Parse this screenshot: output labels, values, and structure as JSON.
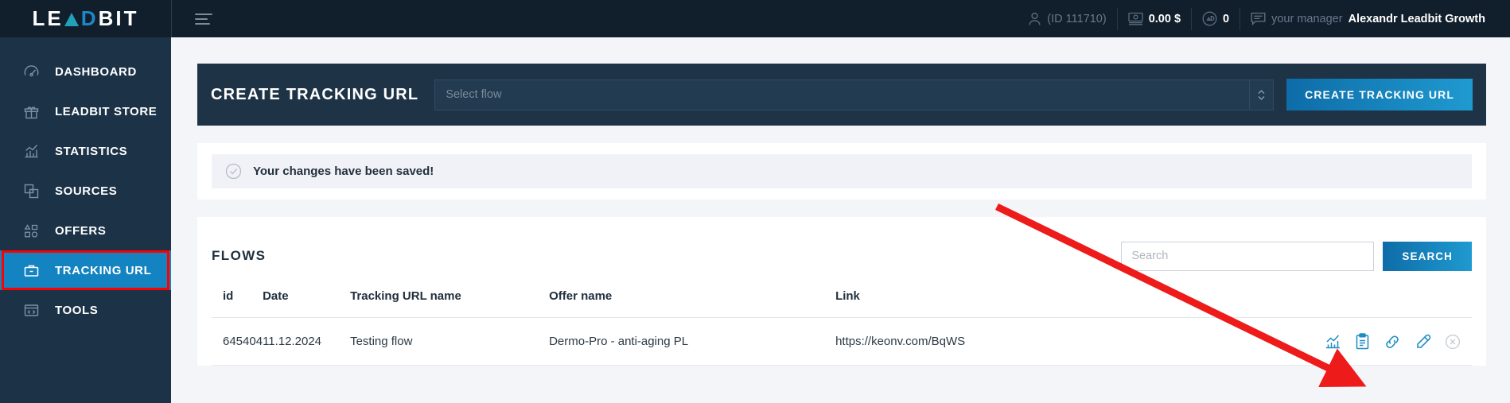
{
  "topbar": {
    "logo": {
      "part1": "LE",
      "triangle_icon": "triangle-a-icon",
      "part2": "D",
      "part3": "BIT"
    },
    "menu_icon": "hamburger-icon",
    "user_icon": "user-icon",
    "user_id": "(ID 111710)",
    "balance_icon": "wallet-icon",
    "balance": "0.00 $",
    "offers_icon": "shapes-badge-icon",
    "offers_count": "0",
    "manager_icon": "chat-icon",
    "manager_label": "your manager",
    "manager_name": "Alexandr Leadbit Growth"
  },
  "sidebar": {
    "items": [
      {
        "label": "DASHBOARD",
        "icon": "speedometer-icon",
        "active": false
      },
      {
        "label": "LEADBIT STORE",
        "icon": "gift-icon",
        "active": false
      },
      {
        "label": "STATISTICS",
        "icon": "bar-chart-icon",
        "active": false
      },
      {
        "label": "SOURCES",
        "icon": "layers-icon",
        "active": false
      },
      {
        "label": "OFFERS",
        "icon": "shapes-icon",
        "active": false
      },
      {
        "label": "TRACKING URL",
        "icon": "briefcase-icon",
        "active": true
      },
      {
        "label": "TOOLS",
        "icon": "code-window-icon",
        "active": false
      }
    ]
  },
  "create_panel": {
    "title": "CREATE TRACKING URL",
    "select_placeholder": "Select flow",
    "select_value": "",
    "spinner_icon": "chevron-up-down-icon",
    "button_label": "CREATE TRACKING URL"
  },
  "alert": {
    "icon": "check-circle-icon",
    "text": "Your changes have been saved!"
  },
  "flows_card": {
    "title": "FLOWS",
    "search_placeholder": "Search",
    "search_value": "",
    "search_button_label": "SEARCH",
    "columns": [
      "id",
      "Date",
      "Tracking URL name",
      "Offer name",
      "Link",
      ""
    ],
    "rows": [
      {
        "id": "645404",
        "date": "11.12.2024",
        "tracking_url_name": "Testing flow",
        "offer_name": "Dermo-Pro - anti-aging PL",
        "link": "https://keonv.com/BqWS",
        "actions": [
          {
            "name": "statistics-icon"
          },
          {
            "name": "clipboard-icon"
          },
          {
            "name": "link-icon"
          },
          {
            "name": "edit-icon"
          },
          {
            "name": "delete-icon"
          }
        ]
      }
    ]
  },
  "annotation": {
    "arrow_color": "#ee1b1b",
    "highlight_color": "#ff0000"
  },
  "colors": {
    "topbar_bg": "#111f2c",
    "sidebar_bg": "#1b3247",
    "accent_blue": "#1383c2",
    "panel_dark": "#1e3346",
    "page_bg": "#f4f5f9"
  }
}
